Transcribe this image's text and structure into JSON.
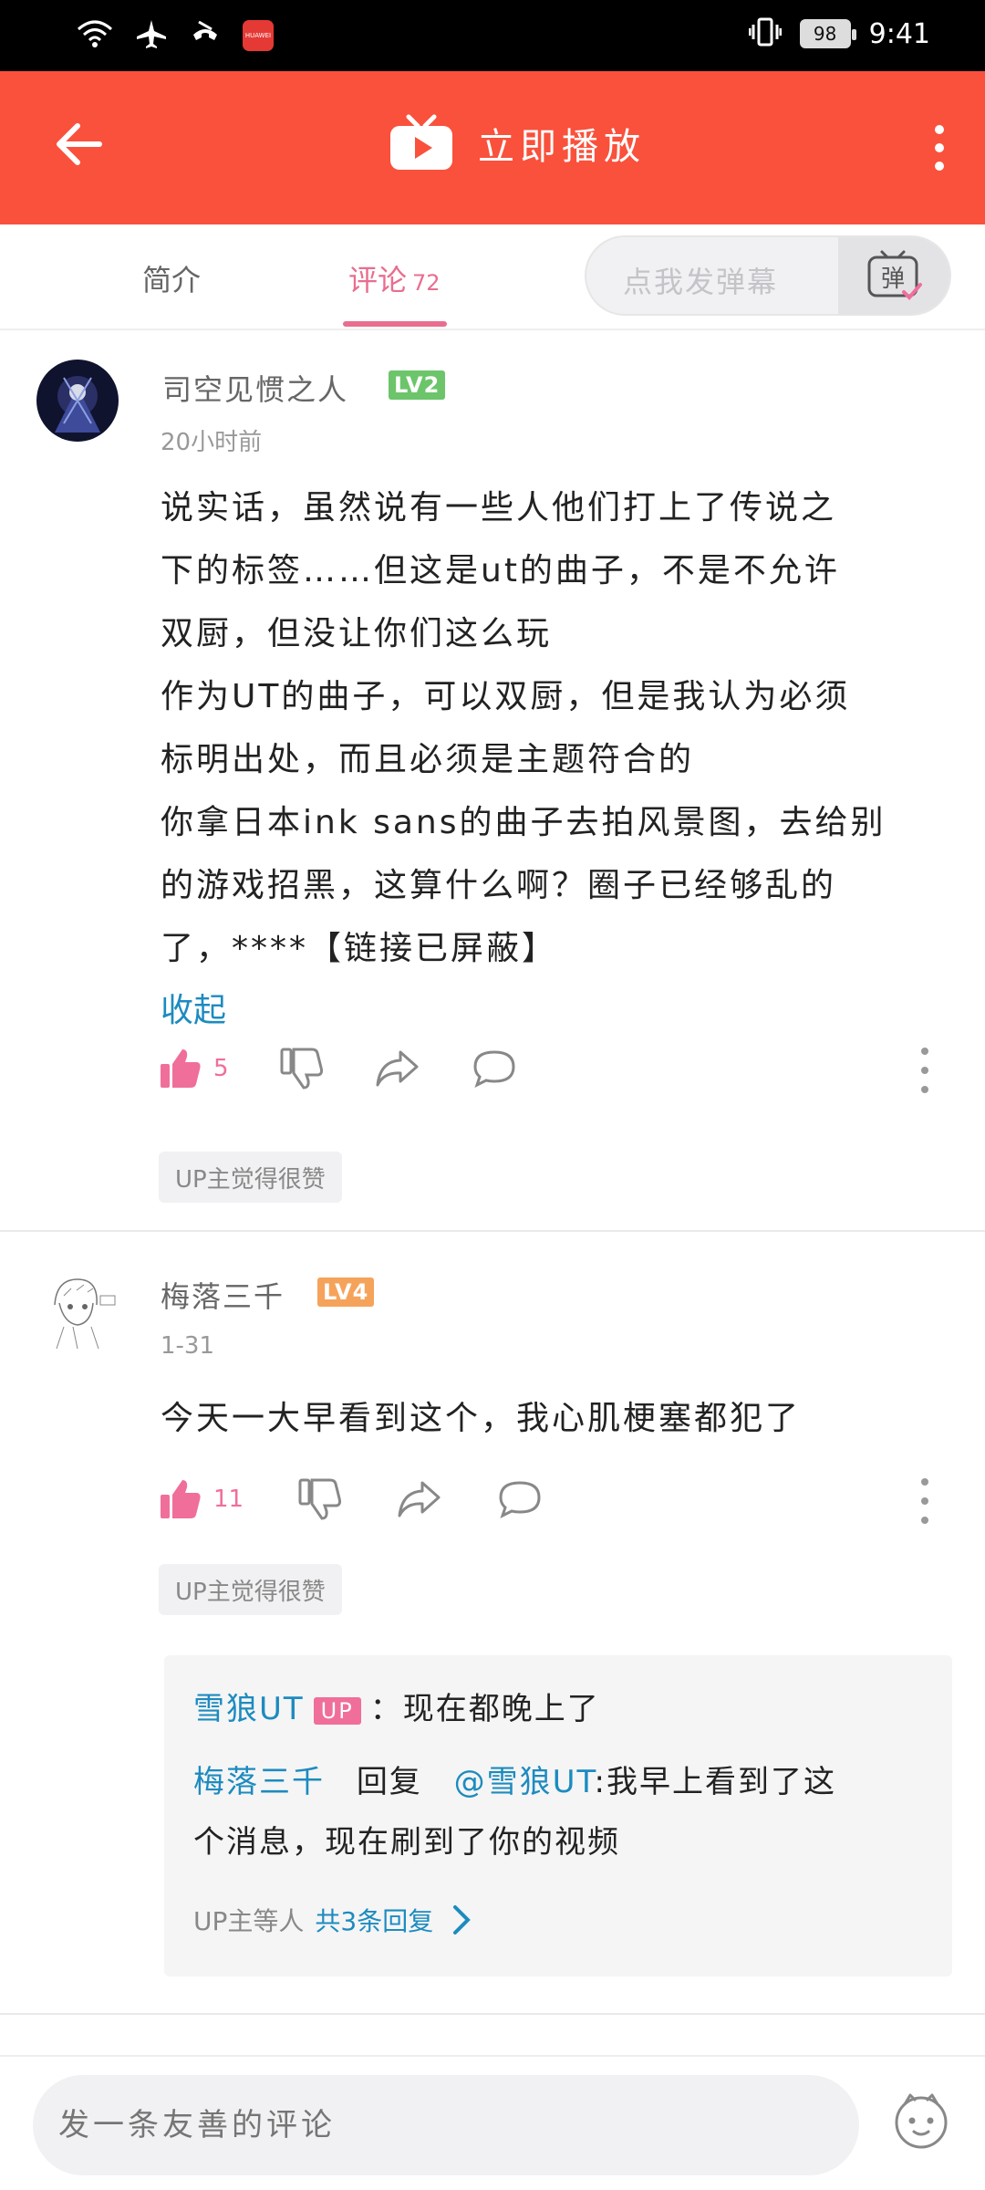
{
  "status_bar": {
    "app_badge": "HUAWEI",
    "battery": "98",
    "time": "9:41"
  },
  "appbar": {
    "title": "立即播放"
  },
  "tabs": {
    "intro_label": "简介",
    "comments_label": "评论",
    "comments_count": "72",
    "danmaku_placeholder": "点我发弹幕",
    "danmaku_button_label": "弹"
  },
  "comments": [
    {
      "username": "司空见惯之人",
      "level": "LV2",
      "level_color": "#6cc56a",
      "time": "20小时前",
      "lines": [
        "说实话，虽然说有一些人他们打上了传说之",
        "下的标签……但这是ut的曲子，不是不允许",
        "双厨，但没让你们这么玩",
        "作为UT的曲子，可以双厨，但是我认为必须",
        "标明出处，而且必须是主题符合的",
        "你拿日本ink sans的曲子去拍风景图，去给别",
        "的游戏招黑，这算什么啊？圈子已经够乱的",
        "了，****【链接已屏蔽】"
      ],
      "collapse_label": "收起",
      "likes": "5",
      "up_tag": "UP主觉得很赞"
    },
    {
      "username": "梅落三千",
      "level": "LV4",
      "level_color": "#f5a35b",
      "time": "1-31",
      "lines": [
        "今天一大早看到这个，我心肌梗塞都犯了"
      ],
      "likes": "11",
      "up_tag": "UP主觉得很赞",
      "replies": {
        "reply1_user": "雪狼UT",
        "reply1_badge": "UP",
        "reply1_text": "：现在都晚上了",
        "reply2_user": "梅落三千",
        "reply2_mid": "回复",
        "reply2_mention": "@雪狼UT",
        "reply2_text_1": ":我早上看到了这",
        "reply2_text_2": "个消息，现在刷到了你的视频",
        "more_prefix": "UP主等人",
        "more_link": "共3条回复"
      }
    }
  ],
  "bottom_bar": {
    "input_placeholder": "发一条友善的评论"
  },
  "colors": {
    "brand_red": "#f9513c",
    "pink_accent": "#e86e8f",
    "link_blue": "#1d8bbf"
  },
  "icons": [
    "wifi-icon",
    "airplane-icon",
    "phone-icon",
    "vibrate-icon",
    "battery-icon",
    "back-arrow-icon",
    "tv-play-icon",
    "more-icon",
    "danmaku-icon",
    "thumb-up-icon",
    "thumb-down-icon",
    "share-icon",
    "reply-icon",
    "chevron-right-icon",
    "emoji-icon"
  ]
}
